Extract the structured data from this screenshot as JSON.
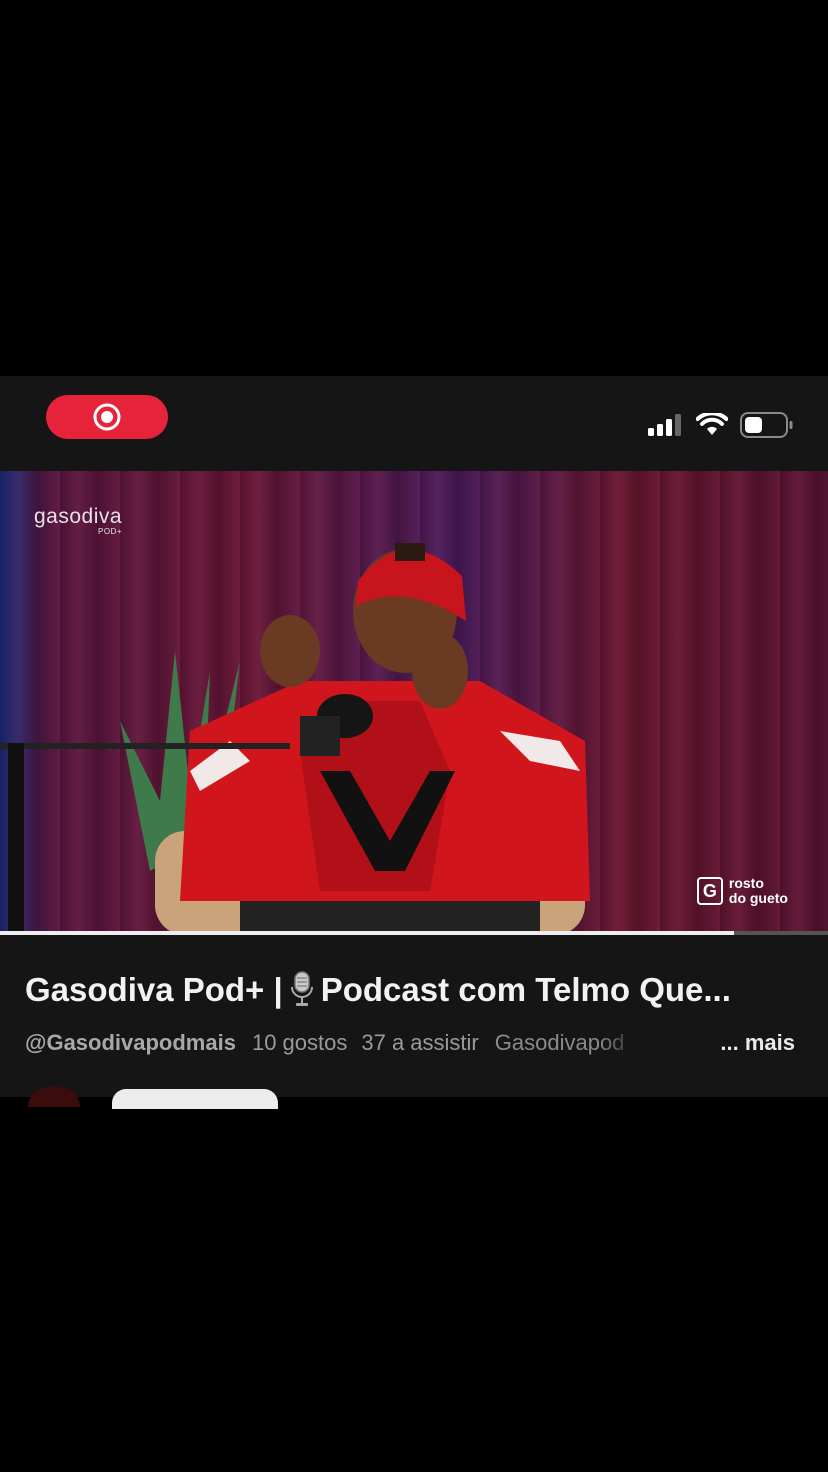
{
  "colors": {
    "record": "#e5243b",
    "bar": "#151515"
  },
  "status_bar": {
    "record_icon": "record-icon",
    "signal_icon": "signal-icon",
    "wifi_icon": "wifi-icon",
    "battery_icon": "battery-icon"
  },
  "video": {
    "watermark": "gasodiva",
    "watermark_sub": "POD+",
    "brand_logo_letter": "G",
    "brand_logo_line1": "rosto",
    "brand_logo_line2": "do gueto",
    "progress": 0.887
  },
  "info": {
    "title_part1": "Gasodiva Pod+ |",
    "title_part2": "Podcast com Telmo Que...",
    "channel": "@Gasodivapodmais",
    "likes": "10 gostos",
    "watching": "37 a assistir",
    "description": "Gasodivapod",
    "more": "... mais"
  }
}
